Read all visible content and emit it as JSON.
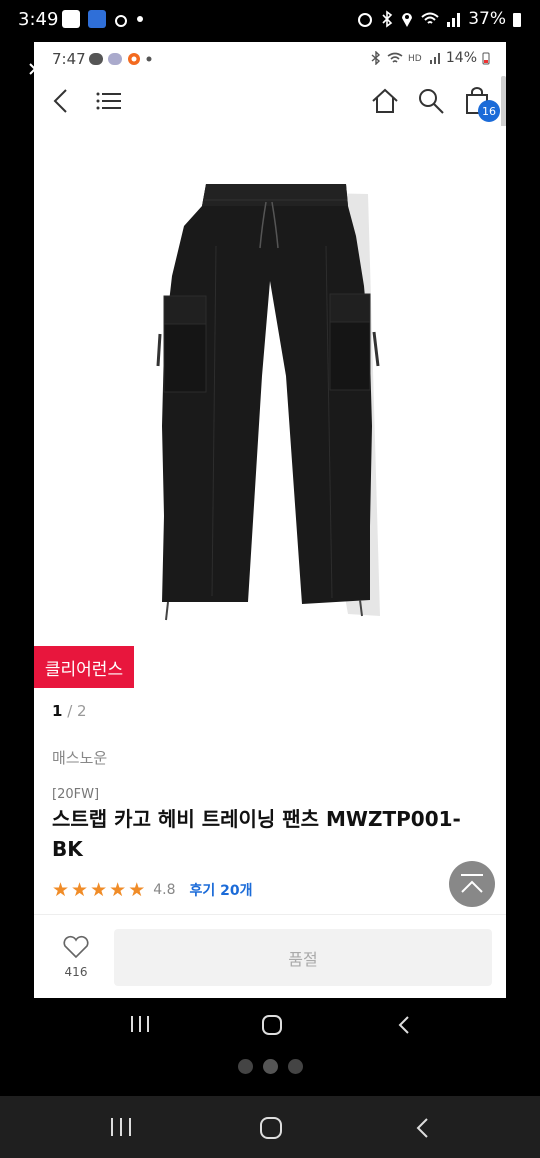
{
  "outer_status": {
    "time": "3:49",
    "battery": "37%"
  },
  "inner_status": {
    "time": "7:47",
    "battery": "14%"
  },
  "header": {
    "cart_count": "16"
  },
  "product": {
    "badge": "클리어런스",
    "pager_current": "1",
    "pager_sep": " / ",
    "pager_total": "2",
    "brand": "매스노운",
    "season": "[20FW]",
    "title": "스트랩 카고 헤비 트레이닝 팬츠 MWZTP001-BK",
    "rating": 4.8,
    "rating_text": "4.8",
    "reviews_text": "후기 20개"
  },
  "bottom_bar": {
    "like_count": "416",
    "action_label": "품절"
  },
  "colors": {
    "badge_red": "#e8163d",
    "link_blue": "#1b6bd8",
    "star_orange": "#f08c28"
  },
  "icons": [
    "back-icon",
    "menu-icon",
    "home-icon",
    "search-icon",
    "shopping-bag-icon",
    "heart-icon",
    "scroll-top-icon",
    "recent-apps-icon",
    "home-nav-icon",
    "back-nav-icon"
  ]
}
